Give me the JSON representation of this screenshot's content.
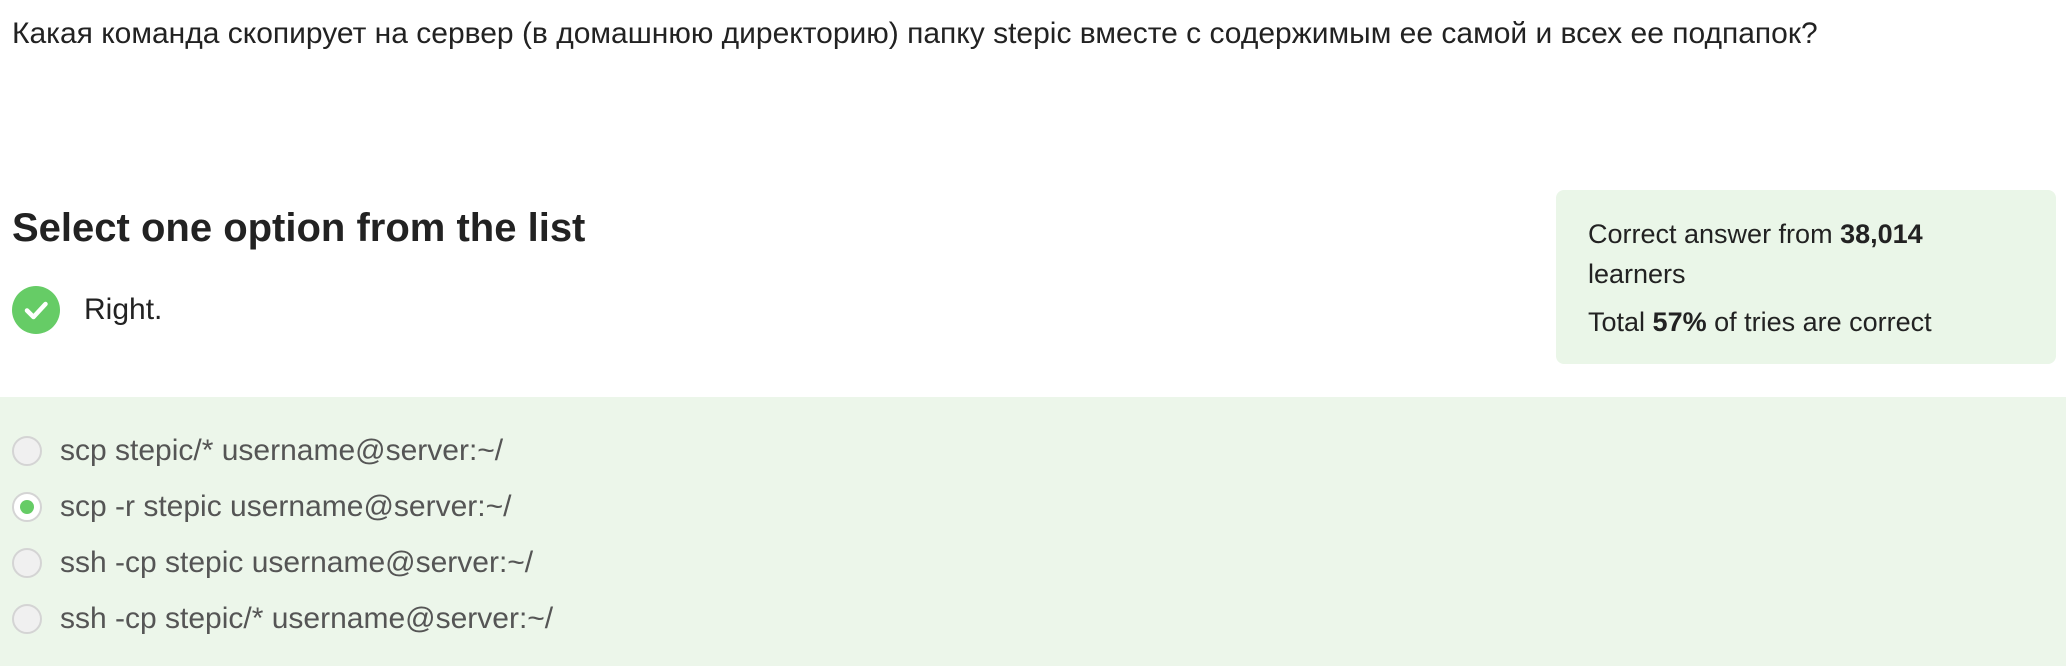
{
  "question": {
    "text": "Какая команда скопирует на сервер (в домашнюю директорию) папку stepic вместе с содержимым ее самой и всех ее подпапок?"
  },
  "quiz": {
    "title": "Select one option from the list",
    "feedback": {
      "icon": "check-icon",
      "label": "Right.",
      "color": "#66cc66"
    },
    "options": [
      {
        "label": "scp stepic/* username@server:~/",
        "selected": false
      },
      {
        "label": "scp -r stepic username@server:~/",
        "selected": true
      },
      {
        "label": "ssh -cp stepic username@server:~/",
        "selected": false
      },
      {
        "label": "ssh -cp stepic/* username@server:~/",
        "selected": false
      }
    ]
  },
  "stats": {
    "line1_prefix": "Correct answer from ",
    "learners_count": "38,014",
    "line1_suffix": "learners",
    "line2_prefix": "Total ",
    "percent": "57%",
    "line2_suffix": " of tries are correct"
  },
  "colors": {
    "accent_green": "#66cc66",
    "options_background": "#ecf6ea",
    "stats_background": "#eaf6e8"
  }
}
